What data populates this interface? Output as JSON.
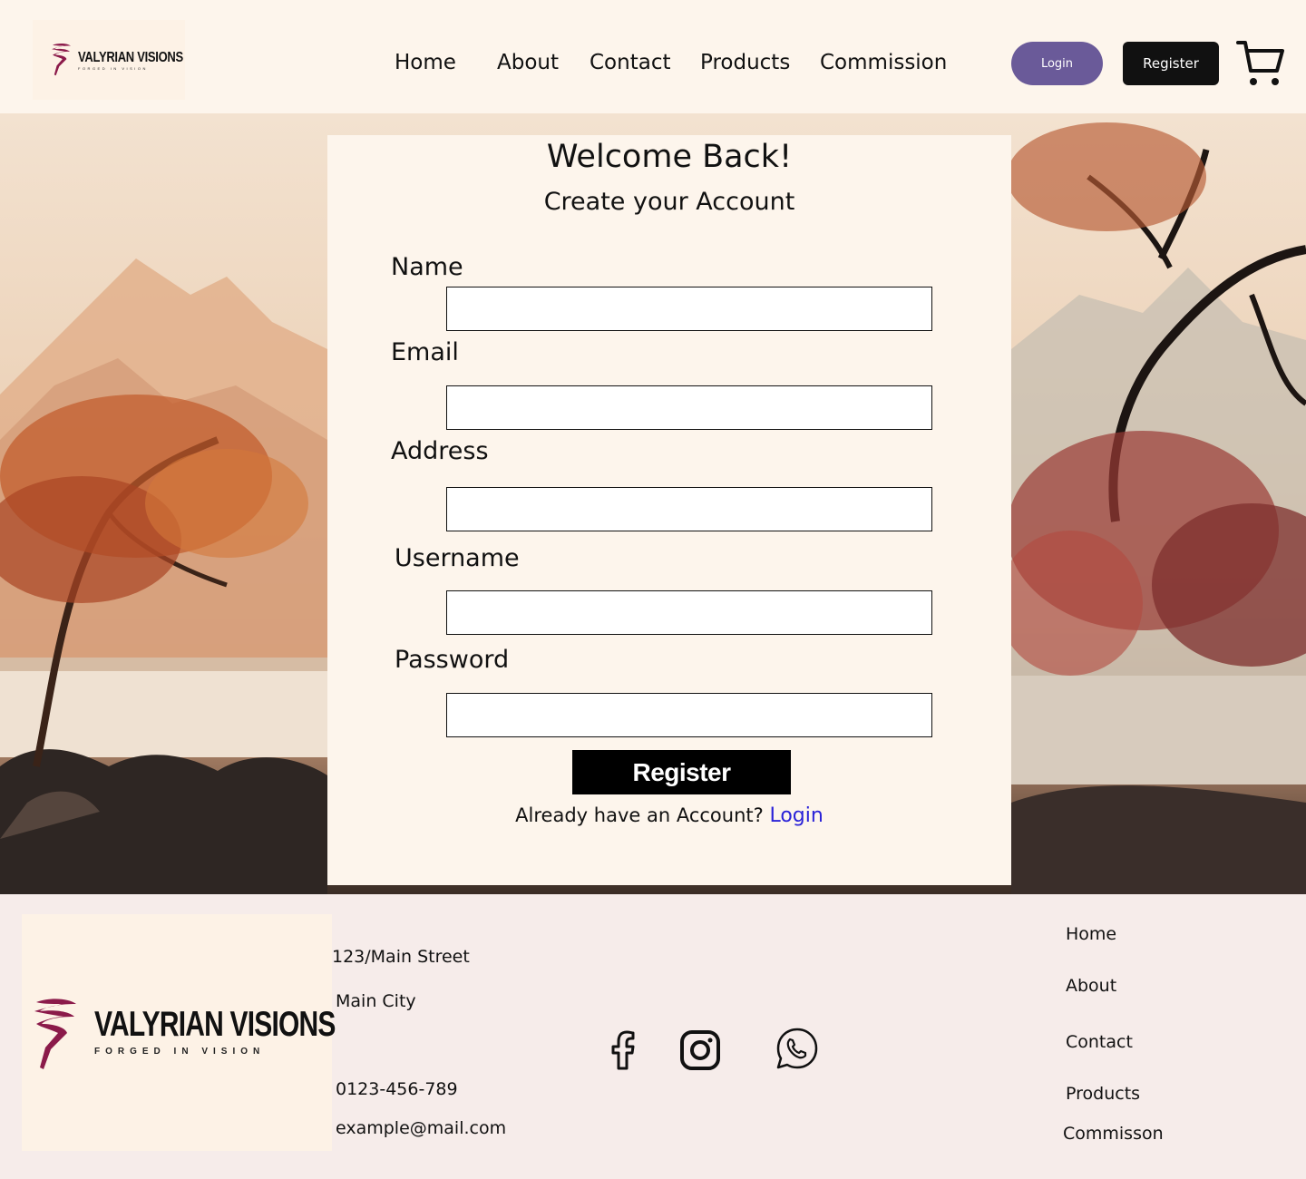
{
  "brand": {
    "name": "VALYRIAN VISIONS",
    "tagline": "FORGED IN VISION",
    "accent_color": "#8b1a4a"
  },
  "nav": {
    "items": [
      "Home",
      "About",
      "Contact",
      "Products",
      "Commission"
    ]
  },
  "header": {
    "login_label": "Login",
    "register_label": "Register",
    "cart_icon": "cart-icon"
  },
  "form": {
    "title": "Welcome Back!",
    "subtitle": "Create your Account",
    "fields": [
      {
        "label": "Name",
        "value": ""
      },
      {
        "label": "Email",
        "value": ""
      },
      {
        "label": "Address",
        "value": ""
      },
      {
        "label": "Username",
        "value": ""
      },
      {
        "label": "Password",
        "value": ""
      }
    ],
    "submit_label": "Register",
    "already_text": "Already have an Account?",
    "login_link": "Login",
    "link_color": "#2a22d8"
  },
  "footer": {
    "address_line1": "123/Main Street",
    "address_line2": "Main City",
    "phone": "0123-456-789",
    "email": "example@mail.com",
    "social": [
      "facebook-icon",
      "instagram-icon",
      "whatsapp-icon"
    ],
    "links": [
      "Home",
      "About",
      "Contact",
      "Products",
      "Commisson"
    ]
  }
}
